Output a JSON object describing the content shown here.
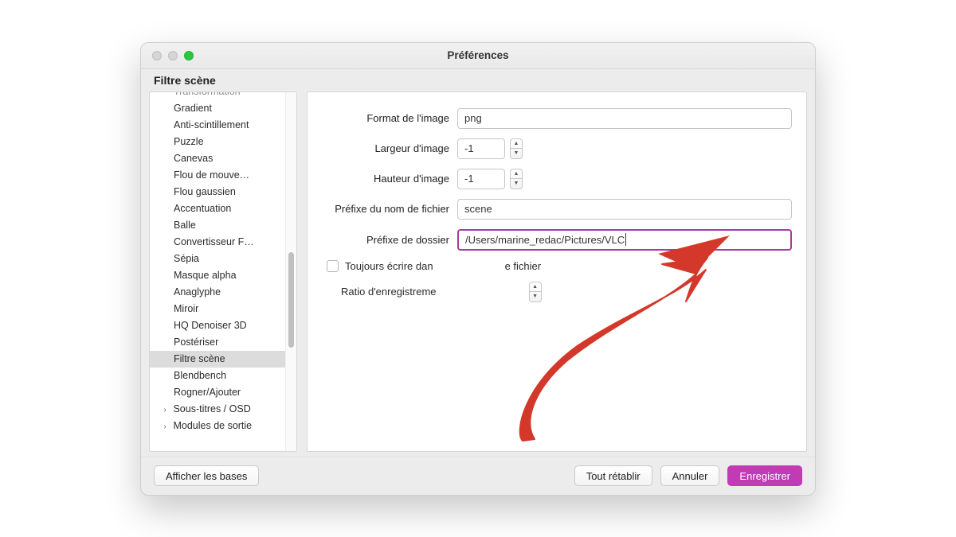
{
  "window": {
    "title": "Préférences",
    "section": "Filtre scène"
  },
  "sidebar": {
    "items": [
      {
        "label": "Transformation",
        "cut": true
      },
      {
        "label": "Gradient"
      },
      {
        "label": "Anti-scintillement"
      },
      {
        "label": "Puzzle"
      },
      {
        "label": "Canevas"
      },
      {
        "label": "Flou de mouve…"
      },
      {
        "label": "Flou gaussien"
      },
      {
        "label": "Accentuation"
      },
      {
        "label": "Balle"
      },
      {
        "label": "Convertisseur F…"
      },
      {
        "label": "Sépia"
      },
      {
        "label": "Masque alpha"
      },
      {
        "label": "Anaglyphe"
      },
      {
        "label": "Miroir"
      },
      {
        "label": "HQ Denoiser 3D"
      },
      {
        "label": "Postériser"
      },
      {
        "label": "Filtre scène",
        "selected": true
      },
      {
        "label": "Blendbench"
      },
      {
        "label": "Rogner/Ajouter"
      }
    ],
    "groups": [
      {
        "label": "Sous-titres / OSD"
      },
      {
        "label": "Modules de sortie"
      }
    ]
  },
  "form": {
    "format_label": "Format de l'image",
    "format_value": "png",
    "width_label": "Largeur d'image",
    "width_value": "-1",
    "height_label": "Hauteur d'image",
    "height_value": "-1",
    "prefix_label": "Préfixe du nom de fichier",
    "prefix_value": "scene",
    "folder_label": "Préfixe de dossier",
    "folder_value": "/Users/marine_redac/Pictures/VLC",
    "always_label_left": "Toujours écrire dan",
    "always_label_right": "e fichier",
    "ratio_label": "Ratio d'enregistreme"
  },
  "footer": {
    "show_basic": "Afficher les bases",
    "reset": "Tout rétablir",
    "cancel": "Annuler",
    "save": "Enregistrer"
  }
}
